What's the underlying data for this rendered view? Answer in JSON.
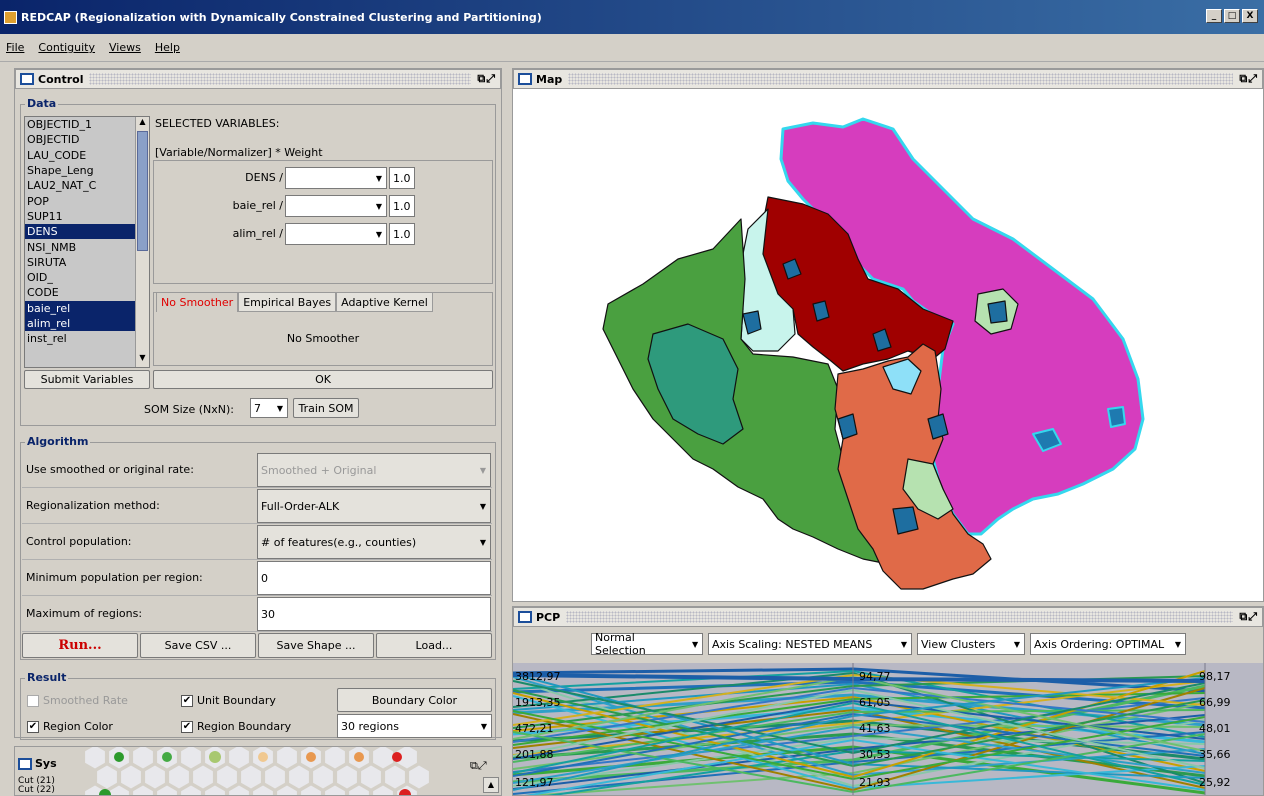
{
  "window": {
    "title": "REDCAP (Regionalization with Dynamically Constrained Clustering and Partitioning)",
    "min": "_",
    "max": "□",
    "close": "X"
  },
  "menu": [
    "File",
    "Contiguity",
    "Views",
    "Help"
  ],
  "control": {
    "title": "Control",
    "data_group": "Data",
    "variables": [
      "OBJECTID_1",
      "OBJECTID",
      "LAU_CODE",
      "Shape_Leng",
      "LAU2_NAT_C",
      "POP",
      "SUP11",
      "DENS",
      "NSI_NMB",
      "SIRUTA",
      "OID_",
      "CODE",
      "baie_rel",
      "alim_rel",
      "inst_rel"
    ],
    "selected_header": "SELECTED VARIABLES:",
    "formula_header": "[Variable/Normalizer] * Weight",
    "selected": [
      {
        "label": "DENS /",
        "weight": "1.0"
      },
      {
        "label": "baie_rel /",
        "weight": "1.0"
      },
      {
        "label": "alim_rel /",
        "weight": "1.0"
      }
    ],
    "tabs": [
      "No Smoother",
      "Empirical Bayes",
      "Adaptive Kernel"
    ],
    "tab_content": "No Smoother",
    "submit": "Submit Variables",
    "ok": "OK",
    "som_label": "SOM Size (NxN):",
    "som_value": "7",
    "train": "Train SOM",
    "alg_group": "Algorithm",
    "alg_rows": [
      {
        "label": "Use smoothed or original rate:",
        "value": "Smoothed + Original"
      },
      {
        "label": "Regionalization method:",
        "value": "Full-Order-ALK"
      },
      {
        "label": "Control population:",
        "value": "# of features(e.g., counties)"
      },
      {
        "label": "Minimum population per region:",
        "value": "0"
      },
      {
        "label": "Maximum of regions:",
        "value": "30"
      }
    ],
    "run": "Run...",
    "save_csv": "Save CSV ...",
    "save_shape": "Save Shape ...",
    "load": "Load...",
    "result_group": "Result",
    "smoothed_rate": "Smoothed Rate",
    "unit_boundary": "Unit Boundary",
    "boundary_color": "Boundary Color",
    "region_color": "Region Color",
    "region_boundary": "Region Boundary",
    "regions_select": "30 regions"
  },
  "sys": {
    "title": "Sys",
    "cut_items": [
      "Cut (21)",
      "Cut (22)"
    ]
  },
  "map": {
    "title": "Map"
  },
  "pcp": {
    "title": "PCP",
    "controls": [
      "Normal Selection",
      "Axis Scaling: NESTED MEANS",
      "View Clusters",
      "Axis Ordering: OPTIMAL"
    ],
    "axis1": [
      "3812,97",
      "1913,35",
      "472,21",
      "201,88",
      "121,97"
    ],
    "axis2": [
      "94,77",
      "61,05",
      "41,63",
      "30,53",
      "21,93"
    ],
    "axis3": [
      "98,17",
      "66,99",
      "48,01",
      "35,66",
      "25,92"
    ]
  },
  "colors": {
    "accent": "#0a246a",
    "run_red": "#cc0000",
    "magenta": "#d63dbe",
    "darkred": "#a00000",
    "green": "#4aa040",
    "orange": "#e06a48"
  }
}
